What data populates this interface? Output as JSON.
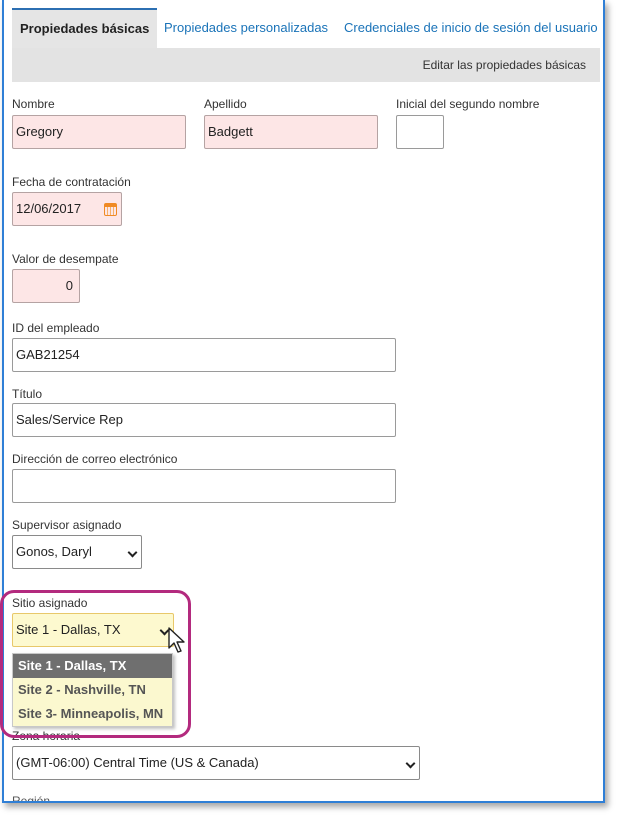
{
  "tabs": [
    {
      "label": "Propiedades básicas",
      "active": true
    },
    {
      "label": "Propiedades personalizadas",
      "active": false
    },
    {
      "label": "Credenciales de inicio de sesión del usuario",
      "active": false
    }
  ],
  "subbar": {
    "edit_link": "Editar las propiedades básicas"
  },
  "fields": {
    "first_name": {
      "label": "Nombre",
      "value": "Gregory"
    },
    "last_name": {
      "label": "Apellido",
      "value": "Badgett"
    },
    "middle_initial": {
      "label": "Inicial del segundo nombre",
      "value": ""
    },
    "hire_date": {
      "label": "Fecha de contratación",
      "value": "12/06/2017"
    },
    "tiebreaker": {
      "label": "Valor de desempate",
      "value": "0"
    },
    "employee_id": {
      "label": "ID del empleado",
      "value": "GAB21254"
    },
    "title": {
      "label": "Título",
      "value": "Sales/Service Rep"
    },
    "email": {
      "label": "Dirección de correo electrónico",
      "value": ""
    },
    "supervisor": {
      "label": "Supervisor asignado",
      "value": "Gonos, Daryl"
    },
    "site": {
      "label": "Sitio asignado",
      "value": "Site 1 - Dallas, TX",
      "options": [
        "Site 1 - Dallas, TX",
        "Site 2 - Nashville, TN",
        "Site 3- Minneapolis, MN"
      ]
    },
    "timezone": {
      "label": "Zona horaria",
      "value": "(GMT-06:00) Central Time (US & Canada)"
    },
    "next_label": "Región"
  },
  "colors": {
    "required_bg": "#fde6e6",
    "site_bg": "#fdf9cf",
    "highlight": "#b32a7e",
    "link": "#1a73b8"
  },
  "icons": [
    "calendar-icon",
    "chevron-down-icon",
    "mouse-cursor-icon"
  ]
}
